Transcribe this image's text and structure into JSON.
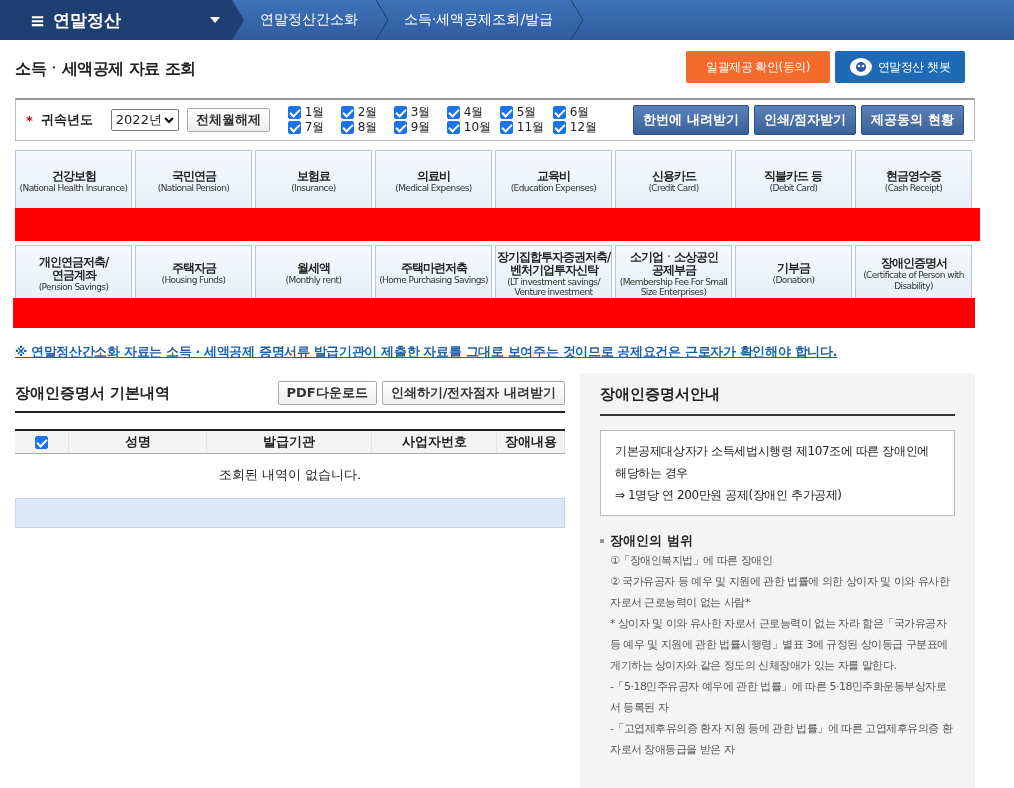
{
  "nav": {
    "menu_icon": "≡",
    "title": "연말정산",
    "breadcrumbs": [
      "연말정산간소화",
      "소득·세액공제조회/발급"
    ]
  },
  "page_title": "소득ㆍ세액공제 자료 조회",
  "top_buttons": [
    {
      "label": "일괄제공 확인(동의)",
      "kind": "orange"
    },
    {
      "label": "연말정산 챗봇",
      "kind": "chatbot"
    }
  ],
  "filter": {
    "label": "귀속년도",
    "required_mark": "*",
    "year": "2022년",
    "toggle_button": "전체월해제",
    "months": [
      {
        "label": "1월",
        "checked": true
      },
      {
        "label": "2월",
        "checked": true
      },
      {
        "label": "3월",
        "checked": true
      },
      {
        "label": "4월",
        "checked": true
      },
      {
        "label": "5월",
        "checked": true
      },
      {
        "label": "6월",
        "checked": true
      },
      {
        "label": "7월",
        "checked": true
      },
      {
        "label": "8월",
        "checked": true
      },
      {
        "label": "9월",
        "checked": true
      },
      {
        "label": "10월",
        "checked": true
      },
      {
        "label": "11월",
        "checked": true
      },
      {
        "label": "12월",
        "checked": true
      }
    ],
    "actions": [
      "한번에 내려받기",
      "인쇄/점자받기",
      "제공동의 현황"
    ]
  },
  "categories": [
    [
      {
        "title": "건강보험",
        "subtitle": "(National Health Insurance)"
      },
      {
        "title": "국민연금",
        "subtitle": "(National Pension)"
      },
      {
        "title": "보험료",
        "subtitle": "(Insurance)"
      },
      {
        "title": "의료비",
        "subtitle": "(Medical Expenses)"
      },
      {
        "title": "교육비",
        "subtitle": "(Education Expenses)"
      },
      {
        "title": "신용카드",
        "subtitle": "(Credit Card)"
      },
      {
        "title": "직불카드 등",
        "subtitle": "(Debit Card)"
      },
      {
        "title": "현금영수증",
        "subtitle": "(Cash Receipt)"
      }
    ],
    [
      {
        "title": "개인연금저축/ 연금계좌",
        "subtitle": "(Pension Savings)"
      },
      {
        "title": "주택자금",
        "subtitle": "(Housing Funds)"
      },
      {
        "title": "월세액",
        "subtitle": "(Monthly rent)"
      },
      {
        "title": "주택마련저축",
        "subtitle": "(Home Purchasing Savings)"
      },
      {
        "title": "장기집합투자증권저축/ 벤처기업투자신탁",
        "subtitle": "(LT investment savings/ Venture investment"
      },
      {
        "title": "소기업ㆍ소상공인 공제부금",
        "subtitle": "(Membership Fee For Small Size Enterprises)"
      },
      {
        "title": "기부금",
        "subtitle": "(Donation)"
      },
      {
        "title": "장애인증명서",
        "subtitle": "(Certificate of Person with Disability)"
      }
    ]
  ],
  "notice": "※ 연말정산간소화 자료는 소득 · 세액공제 증명서류 발급기관이 제출한 자료를 그대로 보여주는 것이므로 공제요건은 근로자가 확인해야 합니다.",
  "section": {
    "title": "장애인증명서 기본내역",
    "buttons": [
      "PDF다운로드",
      "인쇄하기/전자점자 내려받기"
    ],
    "table": {
      "select_all_checked": true,
      "columns": [
        "성명",
        "발급기관",
        "사업자번호",
        "장애내용"
      ],
      "empty_message": "조회된 내역이 없습니다."
    }
  },
  "guide": {
    "title": "장애인증명서안내",
    "box_lines": [
      "기본공제대상자가 소득세법시행령 제107조에 따른 장애인에 해당하는 경우",
      "⇒ 1명당 연 200만원 공제(장애인 추가공제)"
    ],
    "heading": "장애인의 범위",
    "lines": [
      "①「장애인복지법」에 따른 장애인",
      "② 국가유공자 등 예우 및 지원에 관한 법률에 의한 상이자 및 이와 유사한 자로서 근로능력이 없는 사람*",
      "* 상이자 및 이와 유사한 자로서 근로능력이 없는 자라 함은「국가유공자 등 예우 및 지원에 관한 법률시행령」별표 3에 규정된 상이등급 구분표에 게기하는 상이자와 같은 정도의 신체장애가 있는 자를 말한다.",
      "-「5·18민주유공자 예우에 관한 법률」에 따른 5·18민주화운동부상자로서 등록된 자",
      "-「고엽제후유의증 환자 지원 등에 관한 법률」에 따른 고엽제후유의증 환자로서 장애등급을 받은 자"
    ]
  }
}
